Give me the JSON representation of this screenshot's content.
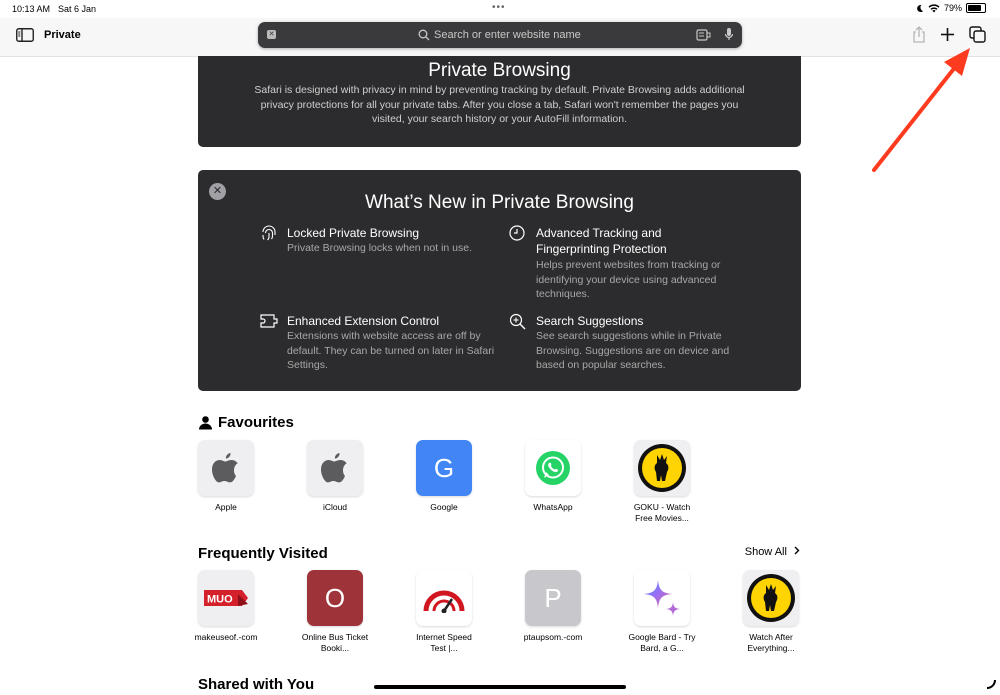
{
  "status": {
    "time": "10:13 AM",
    "date": "Sat 6 Jan",
    "battery": "79%",
    "battery_level": 0.79
  },
  "toolbar": {
    "mode_label": "Private",
    "search_placeholder": "Search or enter website name"
  },
  "privacy_card": {
    "title": "Private Browsing",
    "desc": "Safari is designed with privacy in mind by preventing tracking by default. Private Browsing adds additional privacy protections for all your private tabs. After you close a tab, Safari won't remember the pages you visited, your search history or your AutoFill information."
  },
  "whats_new": {
    "title": "What’s New in Private Browsing",
    "features": [
      {
        "title": "Locked Private Browsing",
        "desc": "Private Browsing locks when not in use.",
        "icon": "fingerprint-icon"
      },
      {
        "title": "Advanced Tracking and Fingerprinting Protection",
        "desc": "Helps prevent websites from tracking or identifying your device using advanced techniques.",
        "icon": "clock-icon"
      },
      {
        "title": "Enhanced Extension Control",
        "desc": "Extensions with website access are off by default. They can be turned on later in Safari Settings.",
        "icon": "extension-icon"
      },
      {
        "title": "Search Suggestions",
        "desc": "See search suggestions while in Private Browsing. Suggestions are on device and based on popular searches.",
        "icon": "magnifier-plus-icon"
      }
    ]
  },
  "favourites": {
    "title": "Favourites",
    "items": [
      {
        "label": "Apple"
      },
      {
        "label": "iCloud"
      },
      {
        "label": "Google",
        "letter": "G"
      },
      {
        "label": "WhatsApp"
      },
      {
        "label": "GOKU - Watch Free Movies..."
      }
    ]
  },
  "frequent": {
    "title": "Frequently Visited",
    "show_all": "Show All",
    "items": [
      {
        "label": "makeuseof.-com",
        "logo_text": "MUO"
      },
      {
        "label": "Online Bus Ticket Booki...",
        "letter": "O"
      },
      {
        "label": "Internet Speed Test |..."
      },
      {
        "label": "ptaupsom.-com",
        "letter": "P"
      },
      {
        "label": "Google Bard - Try Bard, a G..."
      },
      {
        "label": "Watch After Everything..."
      }
    ]
  },
  "shared": {
    "title": "Shared with You"
  },
  "colors": {
    "card_bg": "#2c2c2e",
    "google_blue": "#4285f4",
    "bus_red": "#9e343a",
    "annotation_red": "#ff3b1f"
  }
}
